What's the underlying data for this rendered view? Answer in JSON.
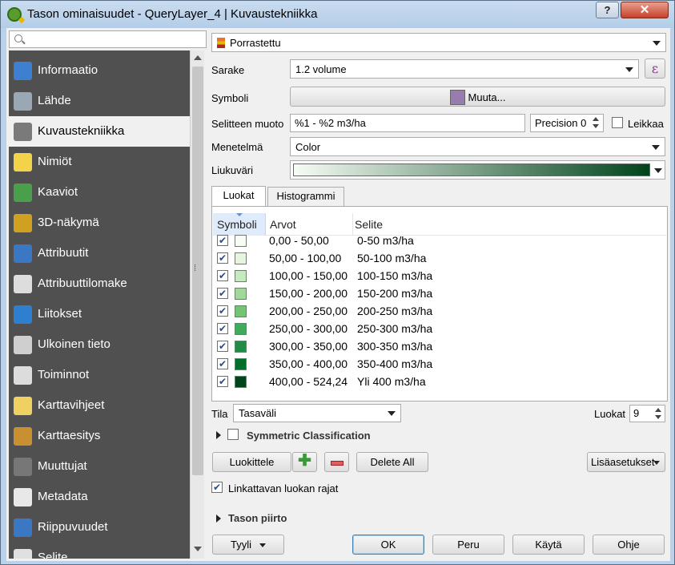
{
  "window": {
    "title": "Tason ominaisuudet - QueryLayer_4 | Kuvaustekniikka",
    "help_label": "?",
    "close_label": "✕"
  },
  "search": {
    "placeholder": ""
  },
  "sidebar": {
    "items": [
      {
        "label": "Informaatio",
        "icon": "info-icon",
        "color": "#3d7fd0"
      },
      {
        "label": "Lähde",
        "icon": "wrench-icon",
        "color": "#9aa7b5"
      },
      {
        "label": "Kuvaustekniikka",
        "icon": "paintbrush-icon",
        "color": "#7a7a7a",
        "active": true
      },
      {
        "label": "Nimiöt",
        "icon": "abc-label-icon",
        "color": "#f2d34a"
      },
      {
        "label": "Kaaviot",
        "icon": "diagram-icon",
        "color": "#4aa04a"
      },
      {
        "label": "3D-näkymä",
        "icon": "cube-3d-icon",
        "color": "#d0a020"
      },
      {
        "label": "Attribuutit",
        "icon": "attribute-table-icon",
        "color": "#3a78c4"
      },
      {
        "label": "Attribuuttilomake",
        "icon": "form-icon",
        "color": "#dddddd"
      },
      {
        "label": "Liitokset",
        "icon": "join-icon",
        "color": "#2f7fd0"
      },
      {
        "label": "Ulkoinen tieto",
        "icon": "database-icon",
        "color": "#cfcfcf"
      },
      {
        "label": "Toiminnot",
        "icon": "gear-play-icon",
        "color": "#dcdcdc"
      },
      {
        "label": "Karttavihjeet",
        "icon": "tooltip-icon",
        "color": "#f0d060"
      },
      {
        "label": "Karttaesitys",
        "icon": "brush-icon",
        "color": "#c89030"
      },
      {
        "label": "Muuttujat",
        "icon": "variable-epsilon-icon",
        "color": "#777777"
      },
      {
        "label": "Metadata",
        "icon": "metadata-icon",
        "color": "#e8e8e8"
      },
      {
        "label": "Riippuvuudet",
        "icon": "dependencies-icon",
        "color": "#3a78c4"
      },
      {
        "label": "Selite",
        "icon": "legend-icon",
        "color": "#e0e0e0"
      }
    ]
  },
  "renderer": {
    "type": "Porrastettu",
    "column_label": "Sarake",
    "column_value": "1.2  volume",
    "symbol_label": "Symboli",
    "symbol_button": "Muuta...",
    "symbol_color": "#9a7bb0",
    "legend_format_label": "Selitteen muoto",
    "legend_format_value": "%1 - %2 m3/ha",
    "precision_label": "Precision 0",
    "trim_label": "Leikkaa",
    "method_label": "Menetelmä",
    "method_value": "Color",
    "color_ramp_label": "Liukuväri",
    "color_ramp": [
      "#f7fcf5",
      "#00441b"
    ]
  },
  "tabs": [
    {
      "label": "Luokat",
      "active": true
    },
    {
      "label": "Histogrammi",
      "active": false
    }
  ],
  "table": {
    "headers": [
      "Symboli",
      "Arvot",
      "Selite"
    ],
    "rows": [
      {
        "values": "0,00 - 50,00",
        "legend": "0-50 m3/ha",
        "color": "#f7fcf5"
      },
      {
        "values": "50,00 - 100,00",
        "legend": "50-100 m3/ha",
        "color": "#e5f5e0"
      },
      {
        "values": "100,00 - 150,00",
        "legend": "100-150 m3/ha",
        "color": "#c7e9c0"
      },
      {
        "values": "150,00 - 200,00",
        "legend": "150-200 m3/ha",
        "color": "#a1d99b"
      },
      {
        "values": "200,00 - 250,00",
        "legend": "200-250 m3/ha",
        "color": "#74c476"
      },
      {
        "values": "250,00 - 300,00",
        "legend": "250-300 m3/ha",
        "color": "#41ab5d"
      },
      {
        "values": "300,00 - 350,00",
        "legend": "300-350 m3/ha",
        "color": "#238b45"
      },
      {
        "values": "350,00 - 400,00",
        "legend": "350-400 m3/ha",
        "color": "#006d2c"
      },
      {
        "values": "400,00 - 524,24",
        "legend": "Yli 400 m3/ha",
        "color": "#00441b"
      }
    ]
  },
  "mode": {
    "label": "Tila",
    "value": "Tasaväli",
    "classes_label": "Luokat",
    "classes_value": "9"
  },
  "symmetric_label": "Symmetric Classification",
  "buttons": {
    "classify": "Luokittele",
    "delete_all": "Delete All",
    "advanced": "Lisäasetukset",
    "link_label": "Linkattavan luokan rajat",
    "layer_rendering": "Tason piirto",
    "style": "Tyyli",
    "ok": "OK",
    "cancel": "Peru",
    "apply": "Käytä",
    "help": "Ohje"
  }
}
